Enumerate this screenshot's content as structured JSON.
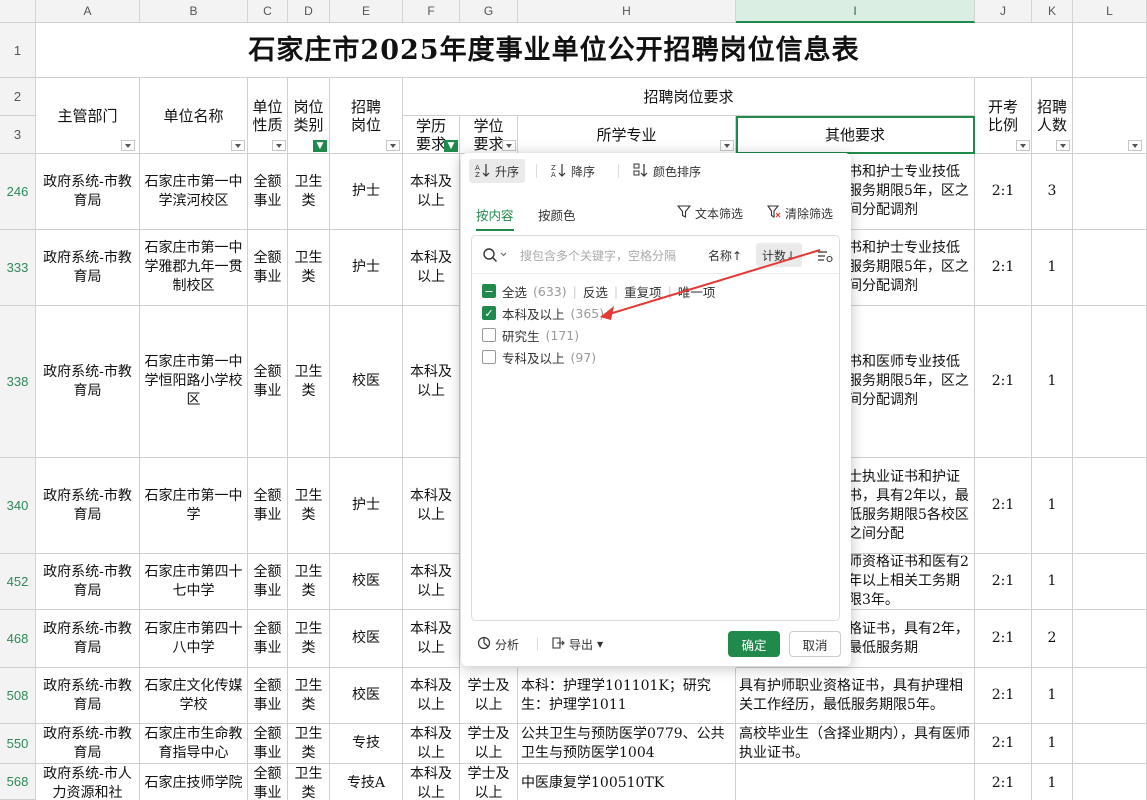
{
  "columns": [
    "A",
    "B",
    "C",
    "D",
    "E",
    "F",
    "G",
    "H",
    "I",
    "J",
    "K",
    "L"
  ],
  "row_numbers": [
    "1",
    "2",
    "3",
    "246",
    "333",
    "338",
    "340",
    "452",
    "468",
    "508",
    "550",
    "568"
  ],
  "title": "石家庄市2025年度事业单位公开招聘岗位信息表",
  "headers": {
    "dept": "主管部门",
    "unit": "单位名称",
    "nature": "单位性质",
    "category": "岗位类别",
    "position": "招聘岗位",
    "requirements": "招聘岗位要求",
    "education": "学历要求",
    "degree": "学位要求",
    "major": "所学专业",
    "other": "其他要求",
    "ratio": "开考比例",
    "count": "招聘人数"
  },
  "rows": [
    {
      "num": "246",
      "dept": "政府系统-市教育局",
      "unit": "石家庄市第一中学滨河校区",
      "nature": "全额事业",
      "cat": "卫生类",
      "pos": "护士",
      "edu": "本科及以上",
      "deg": "",
      "major": "",
      "other": "书和护士专业技低服务期限5年，区之间分配调剂",
      "ratio": "2:1",
      "count": "3"
    },
    {
      "num": "333",
      "dept": "政府系统-市教育局",
      "unit": "石家庄市第一中学雅郡九年一贯制校区",
      "nature": "全额事业",
      "cat": "卫生类",
      "pos": "护士",
      "edu": "本科及以上",
      "deg": "",
      "major": "",
      "other": "书和护士专业技低服务期限5年，区之间分配调剂",
      "ratio": "2:1",
      "count": "1"
    },
    {
      "num": "338",
      "dept": "政府系统-市教育局",
      "unit": "石家庄市第一中学恒阳路小学校区",
      "nature": "全额事业",
      "cat": "卫生类",
      "pos": "校医",
      "edu": "本科及以上",
      "deg": "",
      "major": "",
      "other": "书和医师专业技低服务期限5年，区之间分配调剂",
      "ratio": "2:1",
      "count": "1"
    },
    {
      "num": "340",
      "dept": "政府系统-市教育局",
      "unit": "石家庄市第一中学",
      "nature": "全额事业",
      "cat": "卫生类",
      "pos": "护士",
      "edu": "本科及以上",
      "deg": "",
      "major": "",
      "other": "士执业证书和护证书，具有2年以，最低服务期限5各校区之间分配",
      "ratio": "2:1",
      "count": "1"
    },
    {
      "num": "452",
      "dept": "政府系统-市教育局",
      "unit": "石家庄市第四十七中学",
      "nature": "全额事业",
      "cat": "卫生类",
      "pos": "校医",
      "edu": "本科及以上",
      "deg": "",
      "major": "",
      "other": "师资格证书和医有2年以上相关工务期限3年。",
      "ratio": "2:1",
      "count": "1"
    },
    {
      "num": "468",
      "dept": "政府系统-市教育局",
      "unit": "石家庄市第四十八中学",
      "nature": "全额事业",
      "cat": "卫生类",
      "pos": "校医",
      "edu": "本科及以上",
      "deg": "",
      "major": "",
      "other": "格证书，具有2年，最低服务期",
      "ratio": "2:1",
      "count": "2"
    },
    {
      "num": "508",
      "dept": "政府系统-市教育局",
      "unit": "石家庄文化传媒学校",
      "nature": "全额事业",
      "cat": "卫生类",
      "pos": "校医",
      "edu": "本科及以上",
      "deg": "学士及以上",
      "major": "本科：护理学101101K；研究生：护理学1011",
      "other": "具有护师职业资格证书，具有护理相关工作经历，最低服务期限5年。",
      "ratio": "2:1",
      "count": "1"
    },
    {
      "num": "550",
      "dept": "政府系统-市教育局",
      "unit": "石家庄市生命教育指导中心",
      "nature": "全额事业",
      "cat": "卫生类",
      "pos": "专技",
      "edu": "本科及以上",
      "deg": "学士及以上",
      "major": "公共卫生与预防医学0779、公共卫生与预防医学1004",
      "other": "高校毕业生（含择业期内），具有医师执业证书。",
      "ratio": "2:1",
      "count": "1"
    },
    {
      "num": "568",
      "dept": "政府系统-市人力资源和社",
      "unit": "石家庄技师学院",
      "nature": "全额事业",
      "cat": "卫生类",
      "pos": "专技A",
      "edu": "本科及以上",
      "deg": "学士及以上",
      "major": "中医康复学100510TK",
      "other": "",
      "ratio": "2:1",
      "count": "1"
    }
  ],
  "popup": {
    "sort_asc": "升序",
    "sort_desc": "降序",
    "sort_color": "颜色排序",
    "tab_content": "按内容",
    "tab_color": "按颜色",
    "text_filter": "文本筛选",
    "clear_filter": "清除筛选",
    "search_placeholder": "搜包含多个关键字，空格分隔",
    "sort_name": "名称↑",
    "sort_count": "计数↓",
    "select_all": "全选",
    "select_all_count": "(633)",
    "invert": "反选",
    "duplicates": "重复项",
    "unique": "唯一项",
    "items": [
      {
        "label": "本科及以上",
        "count": "(365)",
        "checked": true
      },
      {
        "label": "研究生",
        "count": "(171)",
        "checked": false
      },
      {
        "label": "专科及以上",
        "count": "(97)",
        "checked": false
      }
    ],
    "analyze": "分析",
    "export": "导出",
    "ok": "确定",
    "cancel": "取消"
  },
  "colors": {
    "accent": "#1f8a4c",
    "arrow": "#e53935"
  }
}
